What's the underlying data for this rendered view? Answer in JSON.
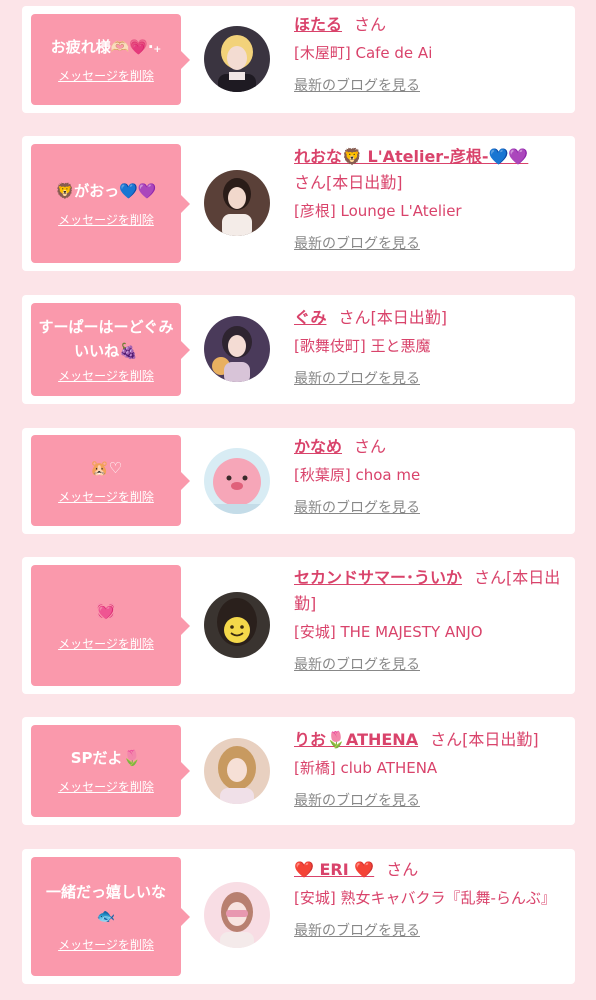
{
  "labels": {
    "san": "さん",
    "delete": "メッセージを削除",
    "blog": "最新のブログを見る"
  },
  "items": [
    {
      "message": "お疲れ様🫶🏻💗‧₊",
      "name": "ほたる",
      "status": "",
      "shop": "[木屋町] Cafe de Ai"
    },
    {
      "message": "🦁がおっ💙💜",
      "name": "れおな🦁 L'Atelier-彦根-💙💜",
      "status": "[本日出勤]",
      "shop": "[彦根] Lounge L'Atelier"
    },
    {
      "message": "すーぱーはーどぐみいいね🍇",
      "name": "ぐみ",
      "status": "[本日出勤]",
      "shop": "[歌舞伎町] 王と悪魔"
    },
    {
      "message": "🐹♡",
      "name": "かなめ",
      "status": "",
      "shop": "[秋葉原] choa me"
    },
    {
      "message": "💓",
      "name": "セカンドサマー･ういか",
      "status": "[本日出勤]",
      "shop": "[安城] THE MAJESTY ANJO"
    },
    {
      "message": "SPだよ🌷",
      "name": "りお🌷ATHENA",
      "status": "[本日出勤]",
      "shop": "[新橋] club ATHENA"
    },
    {
      "message": "一緒だっ嬉しいな🐟",
      "name": "❤️ ERI ❤️",
      "status": "",
      "shop": "[安城] 熟女キャバクラ『乱舞-らんぶ』"
    }
  ]
}
